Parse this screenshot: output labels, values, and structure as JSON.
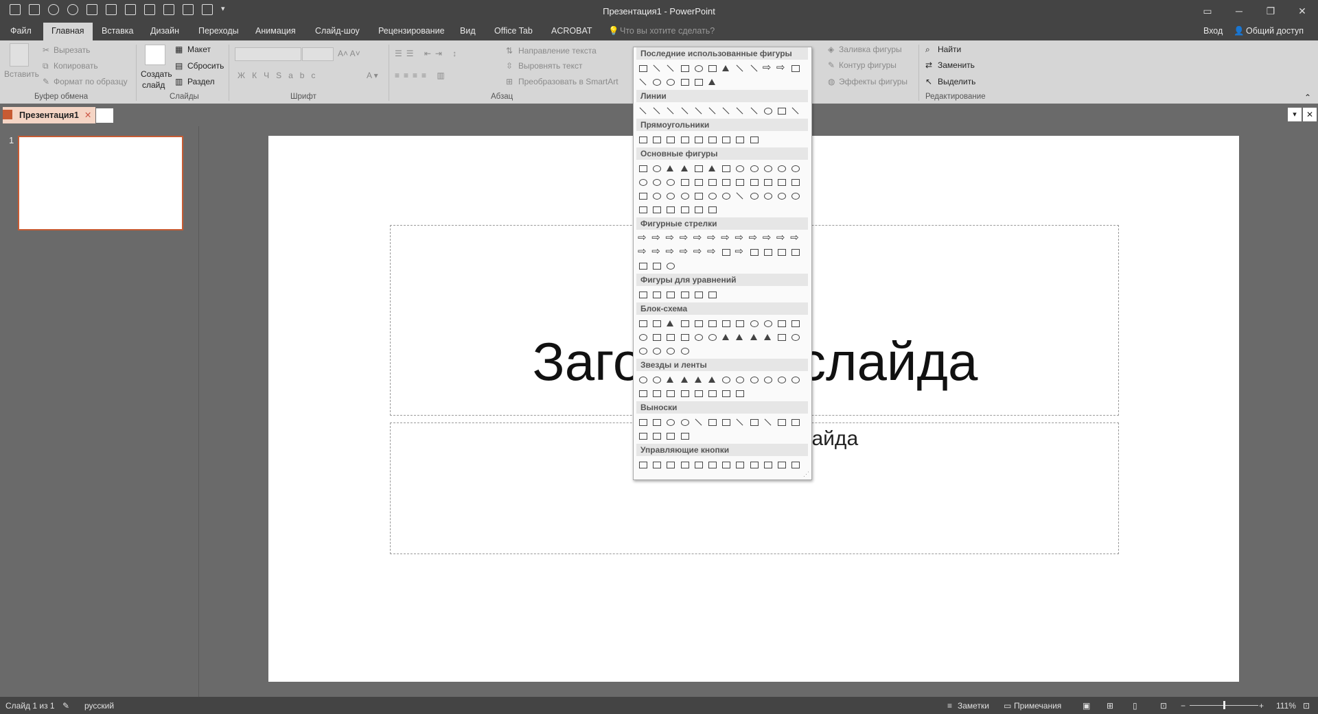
{
  "window": {
    "title": "Презентация1 - PowerPoint",
    "signin": "Вход",
    "share": "Общий доступ"
  },
  "tabs": [
    "Файл",
    "Главная",
    "Вставка",
    "Дизайн",
    "Переходы",
    "Анимация",
    "Слайд-шоу",
    "Рецензирование",
    "Вид",
    "Office Tab",
    "ACROBAT"
  ],
  "tellme": "Что вы хотите сделать?",
  "ribbon": {
    "clipboard": {
      "paste": "Вставить",
      "cut": "Вырезать",
      "copy": "Копировать",
      "format": "Формат по образцу",
      "group": "Буфер обмена"
    },
    "slides": {
      "new": "Создать",
      "new2": "слайд",
      "layout": "Макет",
      "reset": "Сбросить",
      "section": "Раздел",
      "group": "Слайды"
    },
    "font": {
      "group": "Шрифт"
    },
    "paragraph": {
      "direction": "Направление текста",
      "align": "Выровнять текст",
      "smartart": "Преобразовать в SmartArt",
      "group": "Абзац"
    },
    "drawing": {
      "fill": "Заливка фигуры",
      "outline": "Контур фигуры",
      "effects": "Эффекты фигуры"
    },
    "editing": {
      "find": "Найти",
      "replace": "Заменить",
      "select": "Выделить",
      "group": "Редактирование"
    }
  },
  "doc_tab": "Презентация1",
  "thumb_number": "1",
  "slide": {
    "title": "Заголовок слайда",
    "subtitle": "Подзаголовок слайда"
  },
  "gallery": {
    "sections": [
      "Последние использованные фигуры",
      "Линии",
      "Прямоугольники",
      "Основные фигуры",
      "Фигурные стрелки",
      "Фигуры для уравнений",
      "Блок-схема",
      "Звезды и ленты",
      "Выноски",
      "Управляющие кнопки"
    ]
  },
  "status": {
    "slide": "Слайд 1 из 1",
    "lang": "русский",
    "notes": "Заметки",
    "comments": "Примечания",
    "zoom": "111%"
  }
}
